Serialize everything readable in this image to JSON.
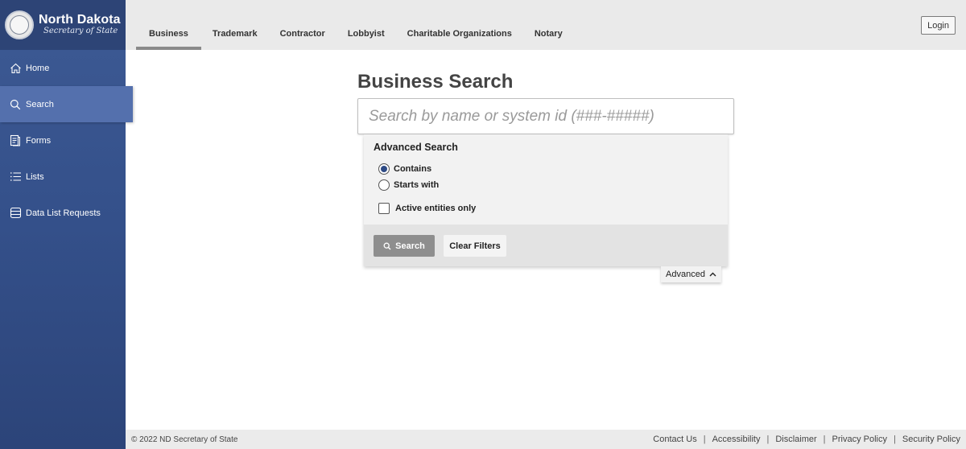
{
  "brand": {
    "title": "North Dakota",
    "subtitle": "Secretary of State"
  },
  "sidebar": {
    "items": [
      {
        "label": "Home",
        "icon": "home-icon"
      },
      {
        "label": "Search",
        "icon": "search-icon",
        "active": true
      },
      {
        "label": "Forms",
        "icon": "forms-icon"
      },
      {
        "label": "Lists",
        "icon": "list-icon"
      },
      {
        "label": "Data List Requests",
        "icon": "database-icon"
      }
    ]
  },
  "header": {
    "tabs": [
      {
        "label": "Business",
        "active": true
      },
      {
        "label": "Trademark"
      },
      {
        "label": "Contractor"
      },
      {
        "label": "Lobbyist"
      },
      {
        "label": "Charitable Organizations"
      },
      {
        "label": "Notary"
      }
    ],
    "login_label": "Login"
  },
  "main": {
    "title": "Business Search",
    "search": {
      "placeholder": "Search by name or system id (###-#####)",
      "value": ""
    },
    "advanced": {
      "title": "Advanced Search",
      "options": [
        {
          "label": "Contains",
          "selected": true
        },
        {
          "label": "Starts with",
          "selected": false
        }
      ],
      "active_only": {
        "label": "Active entities only",
        "checked": false
      },
      "search_label": "Search",
      "clear_label": "Clear Filters",
      "toggle_label": "Advanced"
    }
  },
  "footer": {
    "copyright": "© 2022 ND Secretary of State",
    "links": [
      "Contact Us",
      "Accessibility",
      "Disclaimer",
      "Privacy Policy",
      "Security Policy"
    ]
  },
  "colors": {
    "sidebar": "#34508a",
    "sidebar_active": "#5470ad",
    "radio_selected": "#2e4a85",
    "search_button": "#8e8e8e"
  }
}
